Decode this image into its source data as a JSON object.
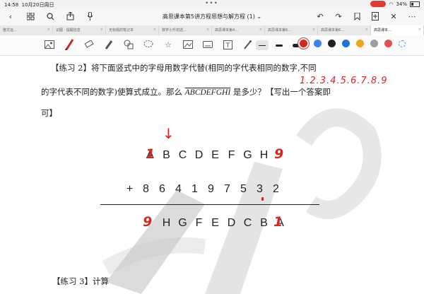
{
  "status": {
    "time": "14:58",
    "date": "10月20日周日",
    "battery": "34%"
  },
  "header": {
    "title": "高思课本第5讲方程思想与解方程 (1)"
  },
  "tabs": [
    "整式运...",
    "识图 · 提醒信息",
    "无标题的笔记本",
    "数学小升初选...",
    "高思课本第4...",
    "高思课本第6...",
    "高思课本第6...",
    "高思课本..."
  ],
  "colors": [
    "#d8261f",
    "#3b82f6",
    "#222222",
    "#1e73d9",
    "#f4a21b",
    "#9e9e9e",
    "#e55050"
  ],
  "content": {
    "line1_label": "【练习 2】",
    "line1_text": "将下面竖式中的字母用数字代替(相同的字代表相同的数字,不同",
    "line2_text": "的字代表不同的数字)使算式成立。那么",
    "line2_var": "ABCDEFGHI",
    "line2_end": "是多少？【写出一个答案即",
    "line3_text": "可】",
    "digits_note": "1.2.3.4.5.6.7.8.9",
    "row1": [
      "A",
      "B",
      "C",
      "D",
      "E",
      "F",
      "G",
      "H",
      "I"
    ],
    "row1_plus": "+",
    "row2": [
      "8",
      "6",
      "4",
      "1",
      "9",
      "7",
      "5",
      "3",
      "2"
    ],
    "row3": [
      "I",
      "H",
      "G",
      "F",
      "E",
      "D",
      "C",
      "B",
      "A"
    ],
    "red_a_top": "1",
    "red_i_top": "9",
    "red_i_bottom": "9",
    "red_a_bottom": "1",
    "arrow": "↓",
    "line4_label": "【练习 3】",
    "line4_text": "计算"
  }
}
